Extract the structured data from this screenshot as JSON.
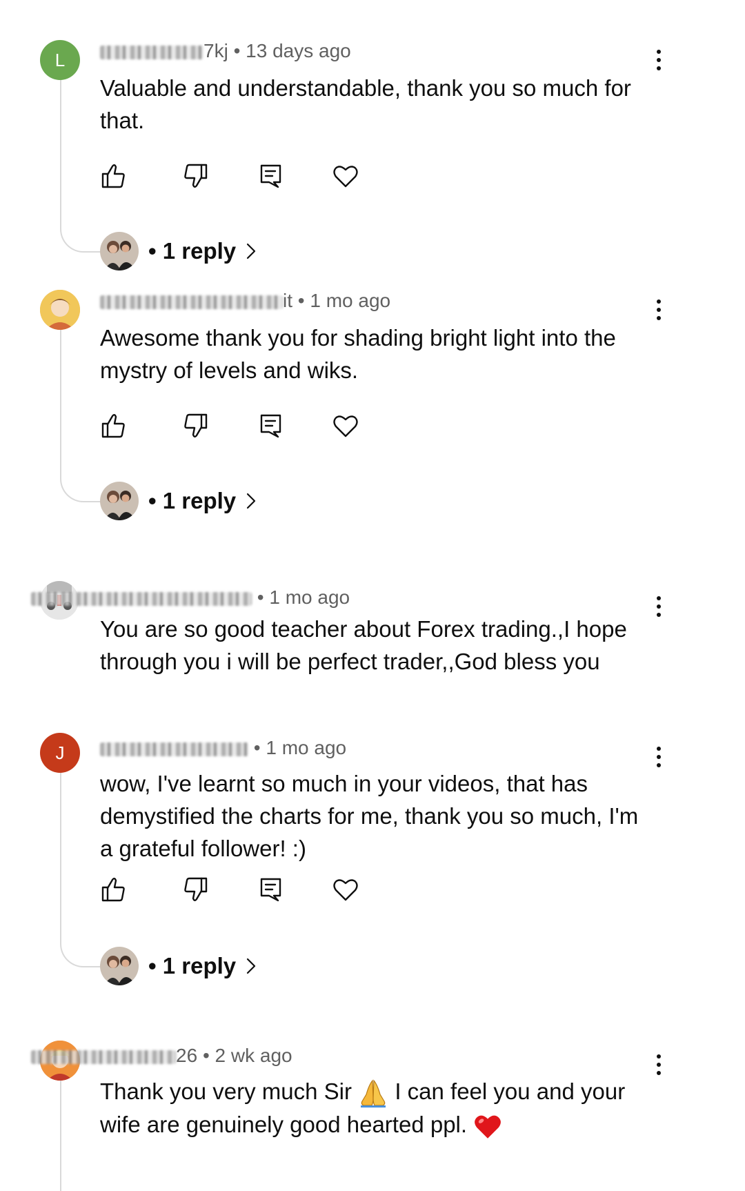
{
  "comments": [
    {
      "author_visible": "7kj",
      "time": "13 days ago",
      "text": "Valuable and understandable, thank you so much for that.",
      "avatar_letter": "L",
      "reply_label": "• 1 reply"
    },
    {
      "author_visible": "it",
      "time": "1 mo ago",
      "text": "Awesome thank you for shading bright light into the mystry of levels and wiks.",
      "reply_label": "• 1 reply"
    },
    {
      "author_visible": "",
      "time": "1 mo ago",
      "text": "You are so good  teacher about Forex trading.,I hope through you i will be perfect trader,,God bless you"
    },
    {
      "author_visible": "",
      "time": "1 mo ago",
      "text": "wow, I've learnt so much in your videos, that has demystified the charts for me, thank you so much, I'm a grateful follower! :)",
      "avatar_letter": "J",
      "reply_label": "• 1 reply"
    },
    {
      "author_visible": "26",
      "time": "2 wk ago",
      "text_part1": "Thank you very much Sir",
      "text_part2": "I can feel you and your wife are genuinely good hearted ppl."
    }
  ],
  "meta_separator": "•",
  "colors": {
    "avatar_green": "#6aa84f",
    "avatar_red": "#c53a1a",
    "thread_line": "#d9d9d9",
    "meta_gray": "#606060"
  },
  "icons": [
    "like-icon",
    "dislike-icon",
    "reply-icon",
    "heart-icon",
    "more-vert-icon",
    "chevron-right-icon",
    "pray-emoji",
    "red-heart-emoji"
  ]
}
